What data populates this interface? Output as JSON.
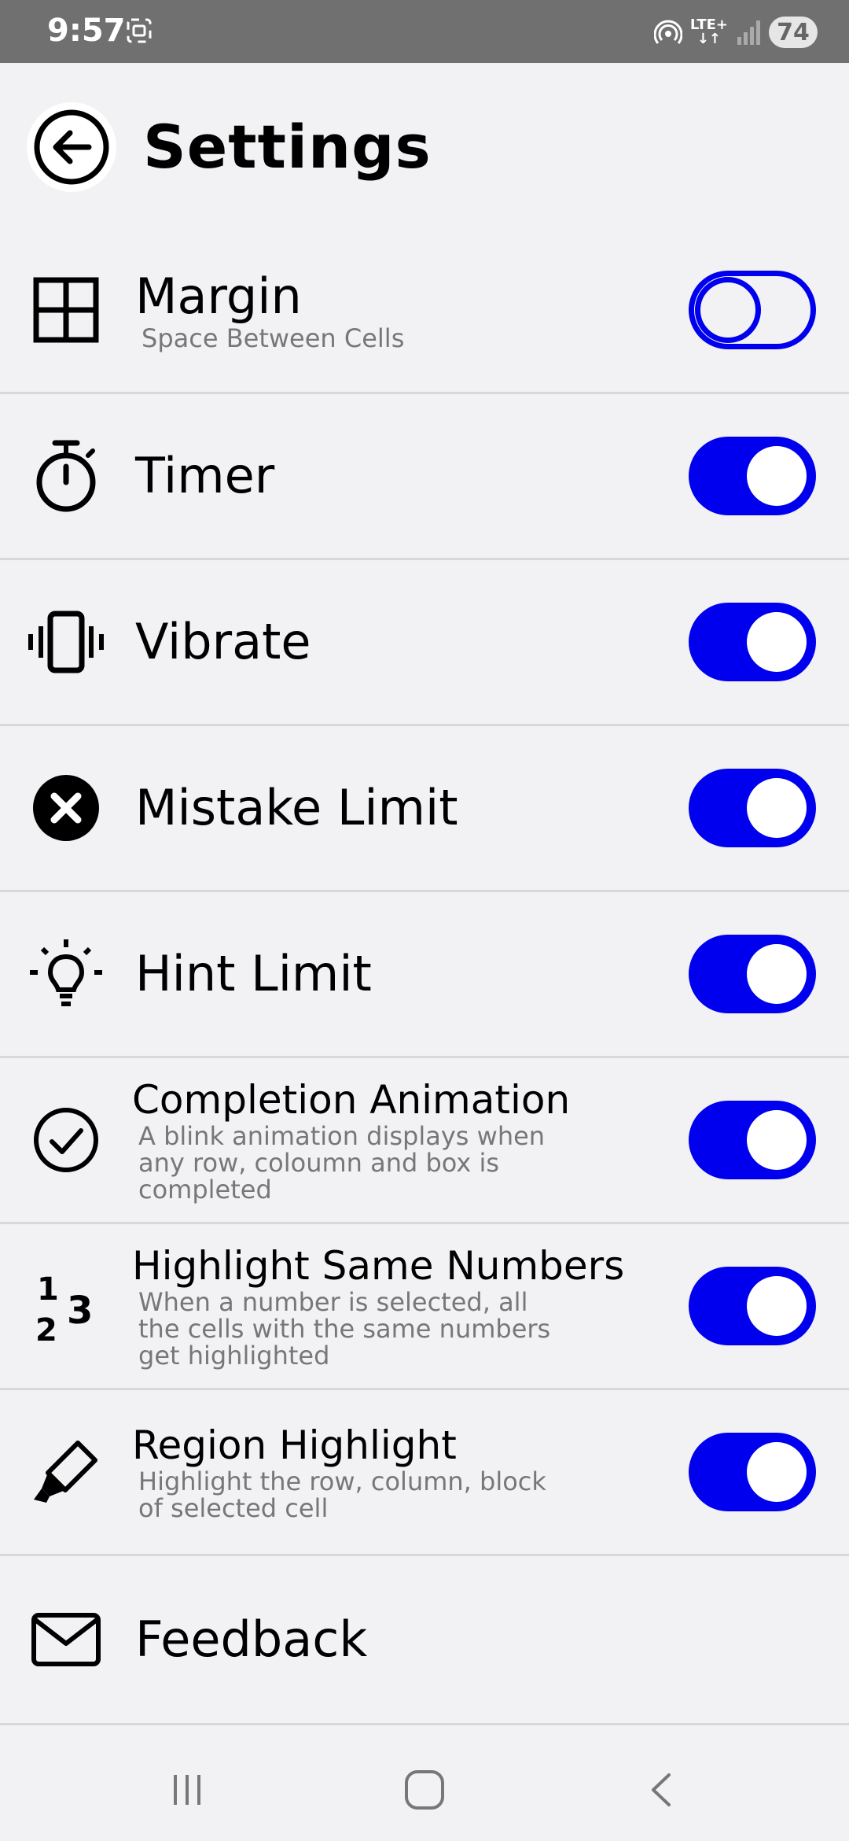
{
  "status": {
    "time": "9:57",
    "network": "LTE+",
    "battery": "74",
    "icons": [
      "screenshot-icon",
      "hotspot-icon",
      "signal-icon"
    ]
  },
  "header": {
    "title": "Settings",
    "back_icon": "back-arrow-icon"
  },
  "accent_color": "#0000ee",
  "settings": [
    {
      "label": "Margin",
      "subtitle": "Space Between Cells",
      "icon": "grid-icon",
      "enabled": false
    },
    {
      "label": "Timer",
      "subtitle": "",
      "icon": "stopwatch-icon",
      "enabled": true
    },
    {
      "label": "Vibrate",
      "subtitle": "",
      "icon": "vibrate-icon",
      "enabled": true
    },
    {
      "label": "Mistake Limit",
      "subtitle": "",
      "icon": "x-circle-icon",
      "enabled": true
    },
    {
      "label": "Hint Limit",
      "subtitle": "",
      "icon": "lightbulb-icon",
      "enabled": true
    },
    {
      "label": "Completion Animation",
      "subtitle": "A blink animation displays when any row, coloumn and box is completed",
      "icon": "check-circle-icon",
      "enabled": true
    },
    {
      "label": "Highlight Same Numbers",
      "subtitle": "When a number is selected, all the cells with the same numbers get highlighted",
      "icon": "numbers-icon",
      "enabled": true
    },
    {
      "label": "Region Highlight",
      "subtitle": "Highlight the row, column, block of selected cell",
      "icon": "highlighter-icon",
      "enabled": true
    }
  ],
  "feedback": {
    "label": "Feedback",
    "icon": "mail-icon"
  },
  "navbar": {
    "icons": [
      "recents-icon",
      "home-icon",
      "back-icon"
    ]
  }
}
